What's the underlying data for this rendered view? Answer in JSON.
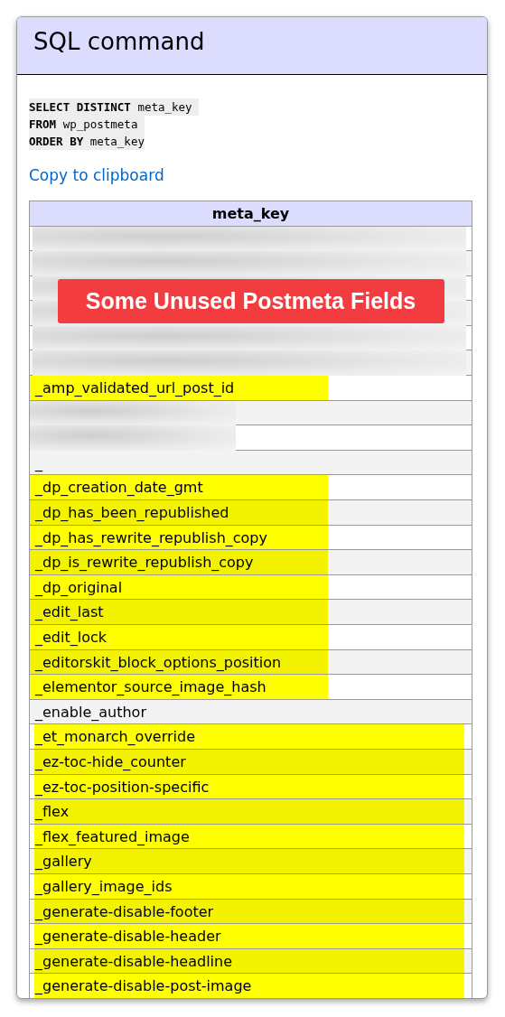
{
  "window": {
    "title": "SQL command"
  },
  "sql_lines": [
    "**SELECT DISTINCT** meta_key ",
    "**FROM** wp_postmeta ",
    "**ORDER BY** meta_key"
  ],
  "copy_link": "Copy to clipboard",
  "banner": "Some Unused Postmeta Fields",
  "table": {
    "columns": [
      "meta_key"
    ],
    "rows": [
      {
        "kind": "redacted",
        "partial": false
      },
      {
        "kind": "redacted",
        "partial": false
      },
      {
        "kind": "redacted",
        "partial": false
      },
      {
        "kind": "redacted",
        "partial": false
      },
      {
        "kind": "redacted",
        "partial": false
      },
      {
        "kind": "redacted",
        "partial": false
      },
      {
        "kind": "text",
        "text": "_amp_validated_url_post_id",
        "highlighted": true,
        "wide": false
      },
      {
        "kind": "redacted",
        "partial": true
      },
      {
        "kind": "redacted",
        "partial": true
      },
      {
        "kind": "text",
        "text": "_",
        "highlighted": false
      },
      {
        "kind": "text",
        "text": "_dp_creation_date_gmt",
        "highlighted": true,
        "wide": false
      },
      {
        "kind": "text",
        "text": "_dp_has_been_republished",
        "highlighted": true,
        "wide": false
      },
      {
        "kind": "text",
        "text": "_dp_has_rewrite_republish_copy",
        "highlighted": true,
        "wide": false
      },
      {
        "kind": "text",
        "text": "_dp_is_rewrite_republish_copy",
        "highlighted": true,
        "wide": false
      },
      {
        "kind": "text",
        "text": "_dp_original",
        "highlighted": true,
        "wide": false
      },
      {
        "kind": "text",
        "text": "_edit_last",
        "highlighted": true,
        "wide": false
      },
      {
        "kind": "text",
        "text": "_edit_lock",
        "highlighted": true,
        "wide": false
      },
      {
        "kind": "text",
        "text": "_editorskit_block_options_position",
        "highlighted": true,
        "wide": false
      },
      {
        "kind": "text",
        "text": "_elementor_source_image_hash",
        "highlighted": true,
        "wide": false
      },
      {
        "kind": "text",
        "text": "_enable_author",
        "highlighted": false
      },
      {
        "kind": "text",
        "text": "_et_monarch_override",
        "highlighted": true,
        "wide": true
      },
      {
        "kind": "text",
        "text": "_ez-toc-hide_counter",
        "highlighted": true,
        "wide": true
      },
      {
        "kind": "text",
        "text": "_ez-toc-position-specific",
        "highlighted": true,
        "wide": true
      },
      {
        "kind": "text",
        "text": "_flex",
        "highlighted": true,
        "wide": true
      },
      {
        "kind": "text",
        "text": "_flex_featured_image",
        "highlighted": true,
        "wide": true
      },
      {
        "kind": "text",
        "text": "_gallery",
        "highlighted": true,
        "wide": true
      },
      {
        "kind": "text",
        "text": "_gallery_image_ids",
        "highlighted": true,
        "wide": true
      },
      {
        "kind": "text",
        "text": "_generate-disable-footer",
        "highlighted": true,
        "wide": true
      },
      {
        "kind": "text",
        "text": "_generate-disable-header",
        "highlighted": true,
        "wide": true
      },
      {
        "kind": "text",
        "text": "_generate-disable-headline",
        "highlighted": true,
        "wide": true
      },
      {
        "kind": "text",
        "text": "_generate-disable-post-image",
        "highlighted": true,
        "wide": true
      }
    ]
  }
}
